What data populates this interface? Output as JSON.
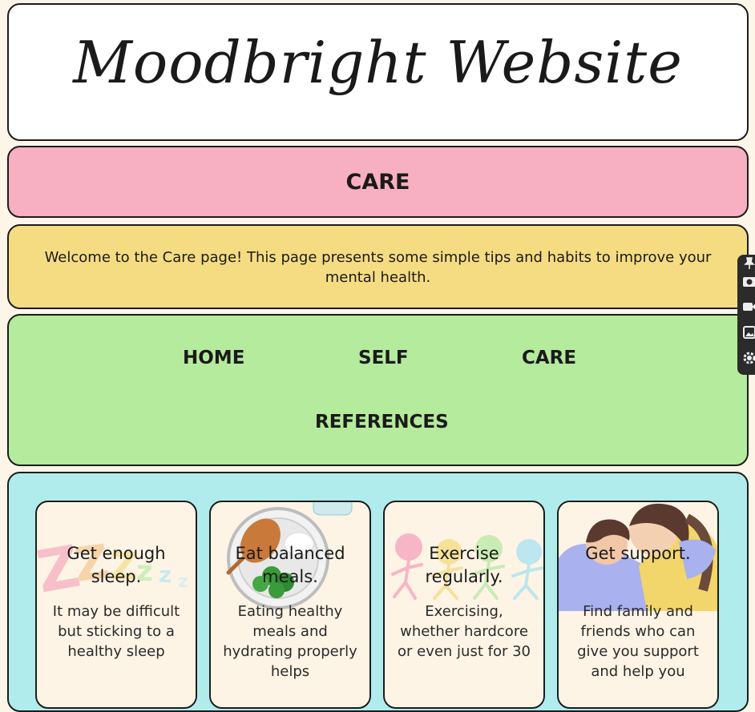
{
  "header": {
    "title": "Moodbright Website"
  },
  "page": {
    "heading": "CARE"
  },
  "welcome": {
    "text": "Welcome to the Care page! This page presents some simple tips and habits to improve your mental health."
  },
  "nav": {
    "items": [
      {
        "label": "HOME"
      },
      {
        "label": "SELF"
      },
      {
        "label": "CARE"
      },
      {
        "label": "REFERENCES"
      }
    ]
  },
  "tips": [
    {
      "title": "Get enough sleep.",
      "body": "It may be difficult but sticking to a healthy sleep",
      "illustration": "sleep-zzz"
    },
    {
      "title": "Eat balanced meals.",
      "body": "Eating healthy meals and hydrating properly helps",
      "illustration": "meal-plate"
    },
    {
      "title": "Exercise regularly.",
      "body": "Exercising, whether hardcore or even just for 30",
      "illustration": "running-figures"
    },
    {
      "title": "Get support.",
      "body": "Find family and friends who can give you support and help you",
      "illustration": "hugging-people"
    }
  ],
  "toolbar": {
    "icons": [
      "pin-icon",
      "camera-icon",
      "video-icon",
      "gallery-icon",
      "gear-icon"
    ]
  },
  "colors": {
    "title_bg": "#ffffff",
    "care_bg": "#f7afc2",
    "welcome_bg": "#f5dc82",
    "nav_bg": "#b4eb9c",
    "tips_bg": "#b1eced",
    "card_bg": "#fdf4e5",
    "page_bg": "#fdf6e8"
  }
}
